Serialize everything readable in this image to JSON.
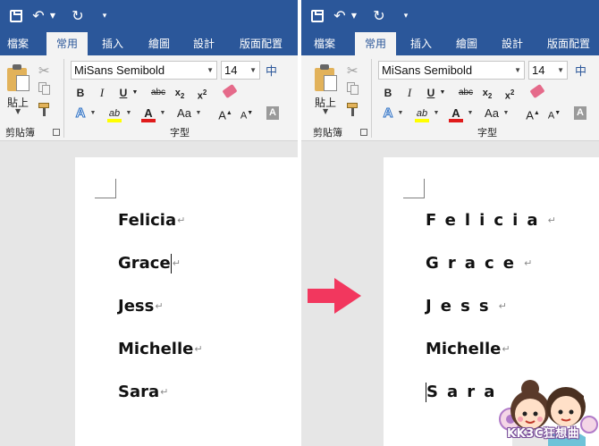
{
  "ribbon": {
    "tabs": [
      "檔案",
      "常用",
      "插入",
      "繪圖",
      "設計",
      "版面配置"
    ],
    "clipboard": {
      "paste_label": "貼上",
      "group_label": "剪貼簿"
    },
    "font": {
      "font_name": "MiSans Semibold",
      "font_size": "14",
      "phonetic_label": "中",
      "bold": "B",
      "italic": "I",
      "underline": "U",
      "strikethrough": "abc",
      "subscript_base": "x",
      "subscript_mark": "2",
      "superscript_base": "x",
      "superscript_mark": "2",
      "text_effects": "A",
      "highlight": "ab",
      "font_color": "A",
      "change_case": "Aa",
      "grow": "A",
      "shrink": "A",
      "char_shading": "A",
      "group_label": "字型"
    }
  },
  "document_before": {
    "lines": [
      "Felicia",
      "Grace",
      "Jess",
      "Michelle",
      "Sara"
    ],
    "pilcrow": "↵"
  },
  "document_after": {
    "lines": [
      "Felicia",
      "Grace",
      "Jess",
      "Michelle",
      "Sara"
    ],
    "pilcrow": "↵"
  },
  "watermark": {
    "text": "KK3C狂想曲"
  },
  "colors": {
    "title_bar": "#2b579a",
    "ribbon_bg": "#f3f3f3",
    "arrow": "#f2375e",
    "highlight_bar": "#ffff00",
    "font_color_bar": "#e01b1b"
  },
  "icons": {
    "save": "save-icon",
    "undo": "undo-icon",
    "redo": "redo-icon",
    "cut": "cut-icon",
    "copy": "copy-icon",
    "format_painter": "format-painter-icon",
    "clear_format": "clear-formatting-icon",
    "arrow": "right-arrow-icon"
  }
}
